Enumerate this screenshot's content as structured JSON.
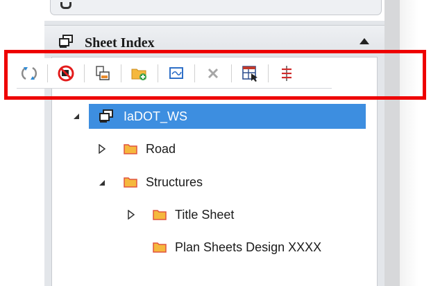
{
  "panel": {
    "title": "Sheet Index",
    "collapse_icon": "chevron-up-icon"
  },
  "toolbar": {
    "buttons": [
      {
        "name": "refresh-icon",
        "tooltip": ""
      },
      {
        "name": "no-entry-icon",
        "tooltip": ""
      },
      {
        "name": "sheet-properties-icon",
        "tooltip": ""
      },
      {
        "name": "add-folder-icon",
        "tooltip": ""
      },
      {
        "name": "add-sheet-icon",
        "tooltip": ""
      },
      {
        "name": "delete-icon",
        "tooltip": ""
      },
      {
        "name": "table-view-icon",
        "tooltip": ""
      },
      {
        "name": "tree-filter-icon",
        "tooltip": ""
      }
    ],
    "highlight_color": "#ee0000"
  },
  "tree": {
    "root": {
      "label": "IaDOT_WS",
      "expanded": true,
      "selected": true
    },
    "items": [
      {
        "label": "Road",
        "expanded": false,
        "has_children": true
      },
      {
        "label": "Structures",
        "expanded": true,
        "has_children": true
      },
      {
        "label": "Title Sheet",
        "expanded": false,
        "has_children": true
      },
      {
        "label": "Plan Sheets Design XXXX",
        "expanded": false,
        "has_children": false
      }
    ]
  },
  "colors": {
    "selection": "#3d8ee0",
    "folder": "#f5b83d",
    "folder_edge": "#e0533e"
  }
}
